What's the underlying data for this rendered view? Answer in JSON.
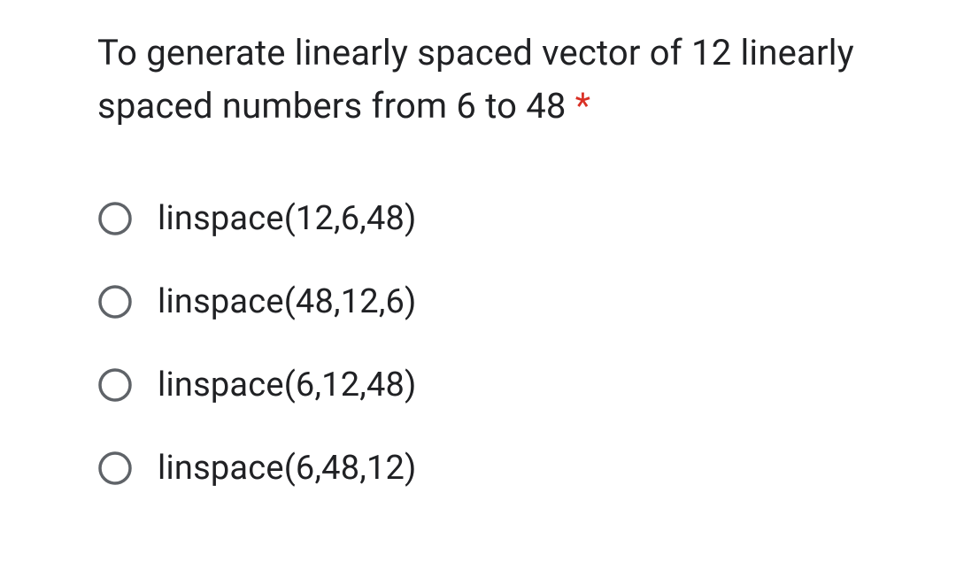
{
  "question": {
    "text": "To generate linearly spaced vector of 12 linearly spaced numbers from 6 to 48",
    "required_mark": "*"
  },
  "options": [
    {
      "label": "linspace(12,6,48)"
    },
    {
      "label": "linspace(48,12,6)"
    },
    {
      "label": "linspace(6,12,48)"
    },
    {
      "label": "linspace(6,48,12)"
    }
  ]
}
